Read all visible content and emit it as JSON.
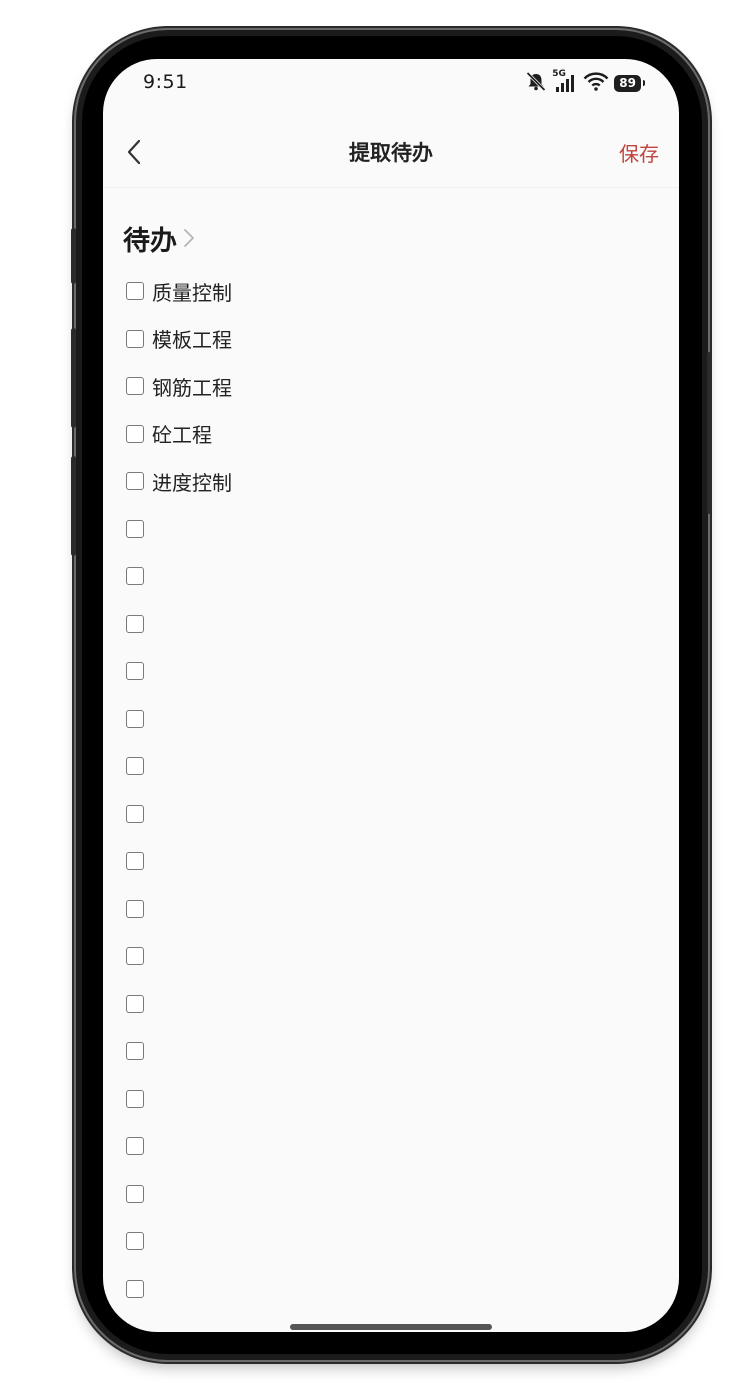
{
  "status_bar": {
    "time": "9:51",
    "network": "5G",
    "battery": "89",
    "icons": [
      "mute-icon",
      "signal-icon",
      "wifi-icon",
      "battery-icon"
    ]
  },
  "nav": {
    "title": "提取待办",
    "save_label": "保存",
    "back_icon": "chevron-left-icon"
  },
  "section": {
    "title": "待办",
    "chevron_icon": "chevron-right-icon"
  },
  "items": [
    {
      "label": "质量控制",
      "checked": false
    },
    {
      "label": "模板工程",
      "checked": false
    },
    {
      "label": "钢筋工程",
      "checked": false
    },
    {
      "label": "砼工程",
      "checked": false
    },
    {
      "label": "进度控制",
      "checked": false
    },
    {
      "label": "",
      "checked": false
    },
    {
      "label": "",
      "checked": false
    },
    {
      "label": "",
      "checked": false
    },
    {
      "label": "",
      "checked": false
    },
    {
      "label": "",
      "checked": false
    },
    {
      "label": "",
      "checked": false
    },
    {
      "label": "",
      "checked": false
    },
    {
      "label": "",
      "checked": false
    },
    {
      "label": "",
      "checked": false
    },
    {
      "label": "",
      "checked": false
    },
    {
      "label": "",
      "checked": false
    },
    {
      "label": "",
      "checked": false
    },
    {
      "label": "",
      "checked": false
    },
    {
      "label": "",
      "checked": false
    },
    {
      "label": "",
      "checked": false
    },
    {
      "label": "",
      "checked": false
    },
    {
      "label": "",
      "checked": false
    }
  ],
  "colors": {
    "accent": "#c0443f",
    "screen_background": "#fafafa"
  }
}
